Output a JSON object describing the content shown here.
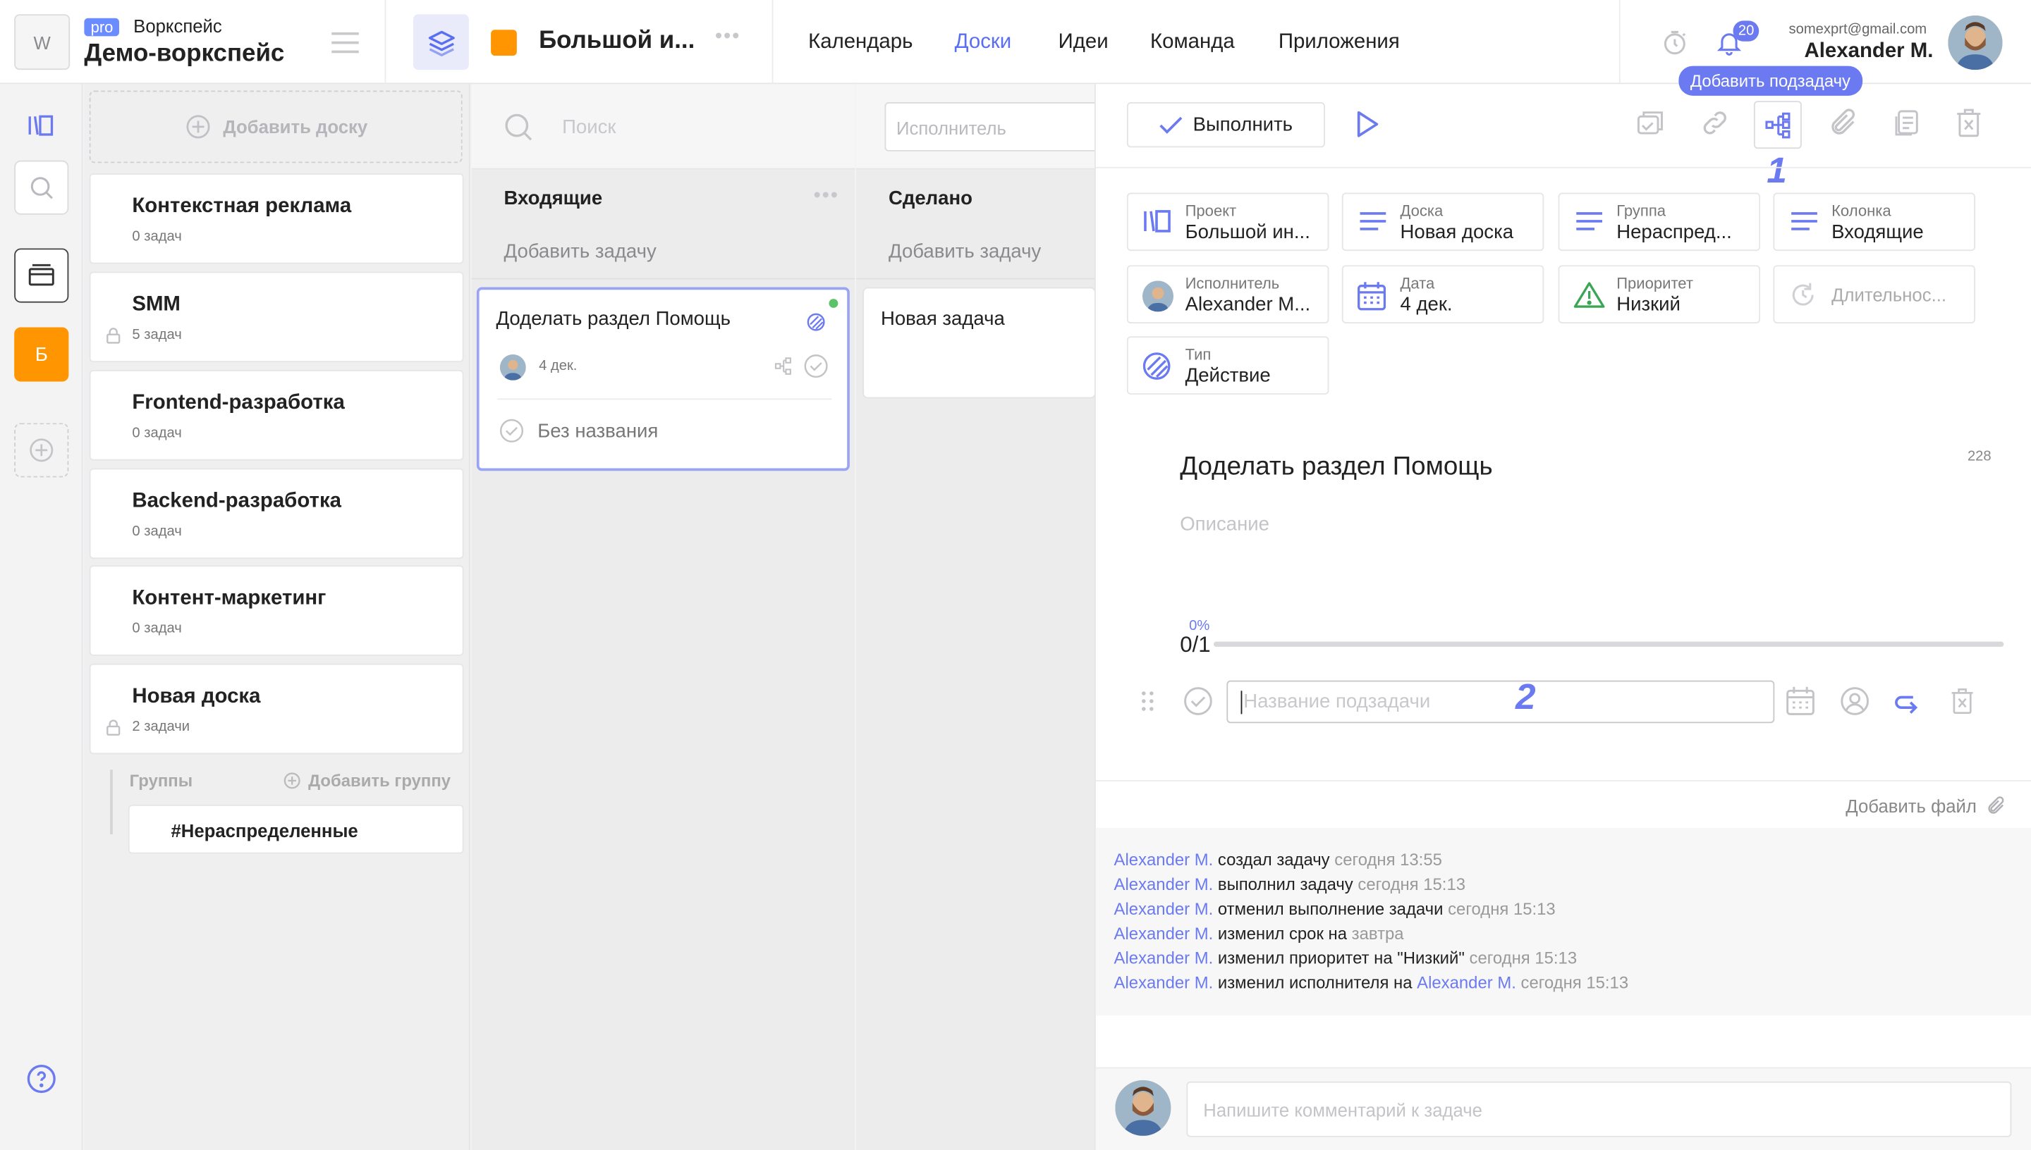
{
  "header": {
    "workspace_logo": "W",
    "pro_badge": "pro",
    "workspace_label": "Воркспейс",
    "workspace_name": "Демо-воркспейс",
    "project_name": "Большой и...",
    "nav": [
      {
        "label": "Календарь"
      },
      {
        "label": "Доски",
        "active": true
      },
      {
        "label": "Идеи"
      },
      {
        "label": "Команда"
      },
      {
        "label": "Приложения"
      }
    ],
    "notifications_count": "20",
    "user_email": "somexprt@gmail.com",
    "user_name": "Alexander M."
  },
  "rail": {
    "board_letter": "Б",
    "accent_color": "#ff9500"
  },
  "boards": {
    "add_label": "Добавить доску",
    "items": [
      {
        "name": "Контекстная реклама",
        "count": "0 задач",
        "locked": false
      },
      {
        "name": "SMM",
        "count": "5 задач",
        "locked": true
      },
      {
        "name": "Frontend-разработка",
        "count": "0 задач",
        "locked": false
      },
      {
        "name": "Backend-разработка",
        "count": "0 задач",
        "locked": false
      },
      {
        "name": "Контент-маркетинг",
        "count": "0 задач",
        "locked": false
      },
      {
        "name": "Новая доска",
        "count": "2 задачи",
        "locked": true
      }
    ],
    "groups_label": "Группы",
    "add_group_label": "Добавить группу",
    "group_item": "#Нераспределенные"
  },
  "kanban": {
    "search_placeholder": "Поиск",
    "assignee_placeholder": "Исполнитель",
    "columns": [
      {
        "title": "Входящие",
        "add": "Добавить задачу"
      },
      {
        "title": "Сделано",
        "add": "Добавить задачу"
      }
    ],
    "card1": {
      "title": "Доделать раздел Помощь",
      "date": "4 дек.",
      "subtask": "Без названия"
    },
    "card2": {
      "title": "Новая задача"
    }
  },
  "panel": {
    "done_label": "Выполнить",
    "tooltip": "Добавить подзадачу",
    "marker1": "1",
    "marker2": "2",
    "props": [
      {
        "label": "Проект",
        "value": "Большой ин...",
        "icon": "project-icon"
      },
      {
        "label": "Доска",
        "value": "Новая доска",
        "icon": "board-icon"
      },
      {
        "label": "Группа",
        "value": "Нераспред...",
        "icon": "group-icon"
      },
      {
        "label": "Колонка",
        "value": "Входящие",
        "icon": "column-icon"
      },
      {
        "label": "Исполнитель",
        "value": "Alexander M...",
        "icon": "avatar"
      },
      {
        "label": "Дата",
        "value": "4 дек.",
        "icon": "calendar-icon"
      },
      {
        "label": "Приоритет",
        "value": "Низкий",
        "icon": "priority-icon"
      },
      {
        "label": "Длительнос...",
        "value": "",
        "icon": "duration-icon"
      },
      {
        "label": "Тип",
        "value": "Действие",
        "icon": "type-icon"
      }
    ],
    "task_title": "Доделать раздел Помощь",
    "task_id": "228",
    "description_placeholder": "Описание",
    "progress_percent": "0%",
    "progress_fraction": 0,
    "progress_count": "0/1",
    "subtask_placeholder": "Название подзадачи",
    "add_file": "Добавить файл",
    "activity": [
      {
        "user": "Alexander M.",
        "action": "создал задачу",
        "time": "сегодня 13:55"
      },
      {
        "user": "Alexander M.",
        "action": "выполнил задачу",
        "time": "сегодня 15:13"
      },
      {
        "user": "Alexander M.",
        "action": "отменил выполнение задачи",
        "time": "сегодня 15:13"
      },
      {
        "user": "Alexander M.",
        "action": "изменил срок на",
        "time": "завтра"
      },
      {
        "user": "Alexander M.",
        "action": "изменил приоритет на \"Низкий\"",
        "time": "сегодня 15:13"
      },
      {
        "user": "Alexander M.",
        "action": "изменил исполнителя на",
        "target": "Alexander M.",
        "time": "сегодня 15:13"
      }
    ],
    "comment_placeholder": "Напишите комментарий к задаче"
  }
}
